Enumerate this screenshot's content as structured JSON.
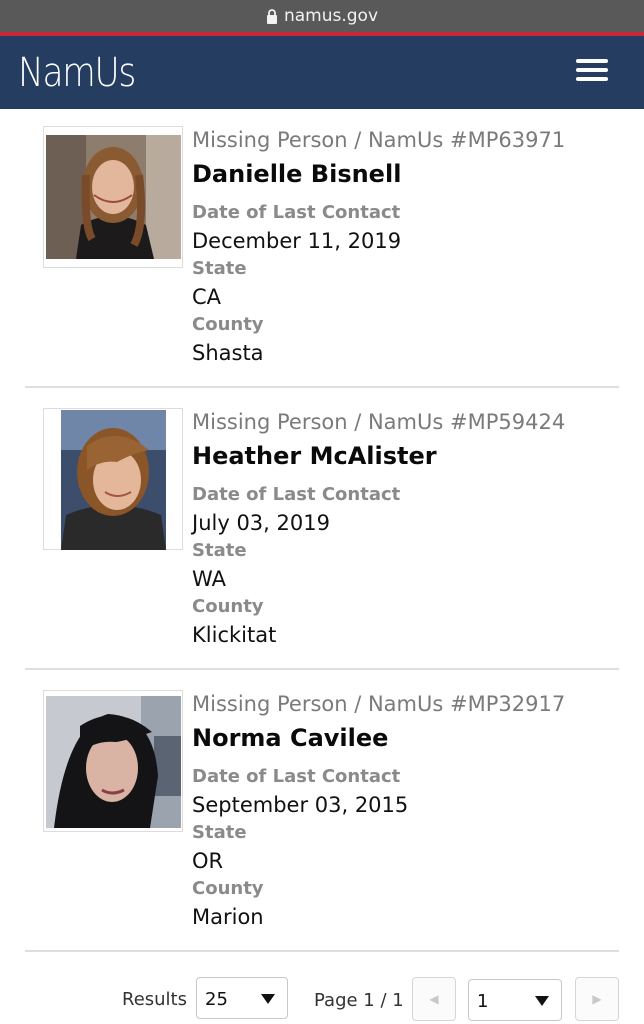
{
  "browser": {
    "url": "namus.gov"
  },
  "header": {
    "brand": "NamUs",
    "menu_icon": "hamburger-menu-icon"
  },
  "labels": {
    "date": "Date of Last Contact",
    "state": "State",
    "county": "County"
  },
  "results": [
    {
      "case": "Missing Person / NamUs #MP63971",
      "name": "Danielle Bisnell",
      "date": "December 11, 2019",
      "state": "CA",
      "county": "Shasta"
    },
    {
      "case": "Missing Person / NamUs #MP59424",
      "name": "Heather McAlister",
      "date": "July 03, 2019",
      "state": "WA",
      "county": "Klickitat"
    },
    {
      "case": "Missing Person / NamUs #MP32917",
      "name": "Norma Cavilee",
      "date": "September 03, 2015",
      "state": "OR",
      "county": "Marion"
    }
  ],
  "pager": {
    "results_label": "Results",
    "per_page": "25",
    "page_text": "Page 1 / 1",
    "page_select": "1",
    "prev_icon": "prev-arrow-icon",
    "next_icon": "next-arrow-icon"
  },
  "colors": {
    "navbar": "#243d60",
    "accent": "#c8283a",
    "urlbar": "#595959"
  }
}
